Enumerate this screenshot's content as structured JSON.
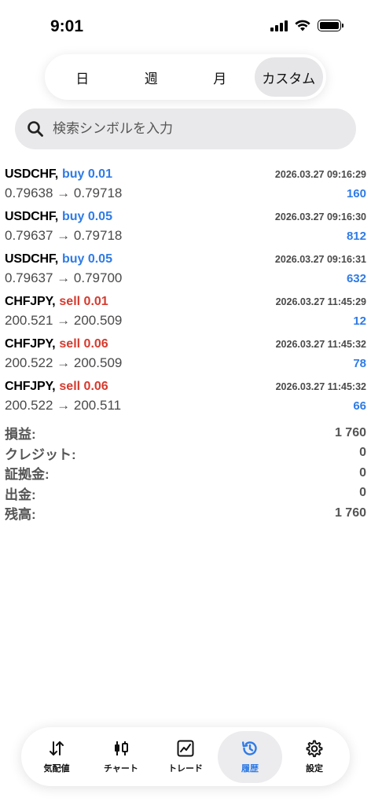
{
  "status_bar": {
    "time": "9:01"
  },
  "period_tabs": [
    {
      "label": "日",
      "active": false
    },
    {
      "label": "週",
      "active": false
    },
    {
      "label": "月",
      "active": false
    },
    {
      "label": "カスタム",
      "active": true
    }
  ],
  "search": {
    "placeholder": "検索シンボルを入力",
    "value": ""
  },
  "trades": [
    {
      "symbol": "USDCHF,",
      "side": "buy",
      "lots": "buy 0.01",
      "time": "2026.03.27 09:16:29",
      "prices": "0.79638 → 0.79718",
      "profit": "160"
    },
    {
      "symbol": "USDCHF,",
      "side": "buy",
      "lots": "buy 0.05",
      "time": "2026.03.27 09:16:30",
      "prices": "0.79637 → 0.79718",
      "profit": "812"
    },
    {
      "symbol": "USDCHF,",
      "side": "buy",
      "lots": "buy 0.05",
      "time": "2026.03.27 09:16:31",
      "prices": "0.79637 → 0.79700",
      "profit": "632"
    },
    {
      "symbol": "CHFJPY,",
      "side": "sell",
      "lots": "sell 0.01",
      "time": "2026.03.27 11:45:29",
      "prices": "200.521 → 200.509",
      "profit": "12"
    },
    {
      "symbol": "CHFJPY,",
      "side": "sell",
      "lots": "sell 0.06",
      "time": "2026.03.27 11:45:32",
      "prices": "200.522 → 200.509",
      "profit": "78"
    },
    {
      "symbol": "CHFJPY,",
      "side": "sell",
      "lots": "sell 0.06",
      "time": "2026.03.27 11:45:32",
      "prices": "200.522 → 200.511",
      "profit": "66"
    }
  ],
  "summary": [
    {
      "label": "損益:",
      "value": "1 760"
    },
    {
      "label": "クレジット:",
      "value": "0"
    },
    {
      "label": "証拠金:",
      "value": "0"
    },
    {
      "label": "出金:",
      "value": "0"
    },
    {
      "label": "残高:",
      "value": "1 760"
    }
  ],
  "nav": [
    {
      "label": "気配値",
      "icon": "quotes-arrows-icon",
      "active": false
    },
    {
      "label": "チャート",
      "icon": "candlestick-icon",
      "active": false
    },
    {
      "label": "トレード",
      "icon": "trade-chart-icon",
      "active": false
    },
    {
      "label": "履歴",
      "icon": "history-clock-icon",
      "active": true
    },
    {
      "label": "設定",
      "icon": "gear-icon",
      "active": false
    }
  ],
  "colors": {
    "buy": "#2f7be6",
    "sell": "#d63a2e",
    "profit": "#2f7be6",
    "active_nav": "#2f7be6"
  }
}
